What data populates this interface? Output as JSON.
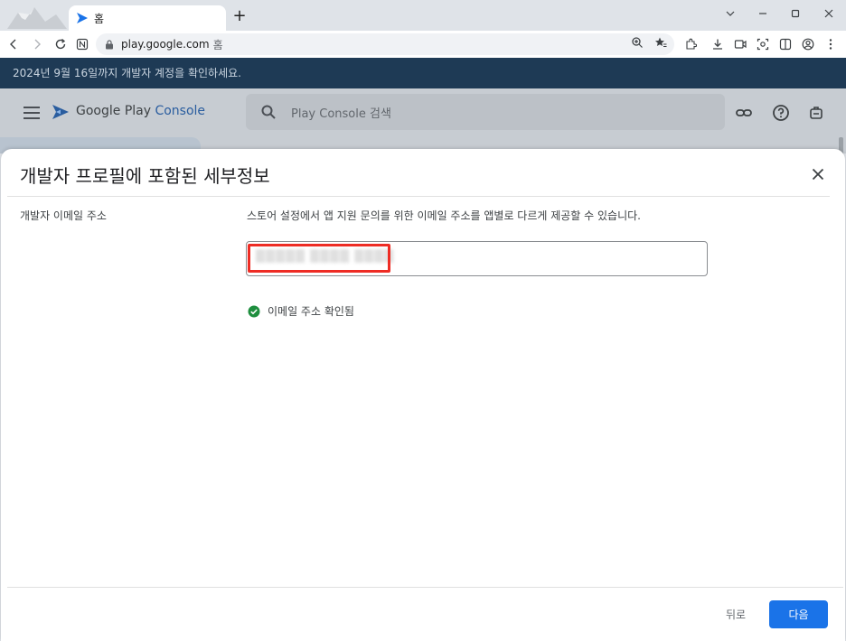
{
  "browser": {
    "tab_title": "홈",
    "new_tab_symbol": "+",
    "url": "play.google.com",
    "url_suffix": "홈"
  },
  "banner": {
    "text": "2024년 9월 16일까지 개발자 계정을 확인하세요."
  },
  "console": {
    "brand_prefix": "Google Play",
    "brand_accent": "Console",
    "search_placeholder": "Play Console 검색"
  },
  "dialog": {
    "title": "개발자 프로필에 포함된 세부정보",
    "field_label": "개발자 이메일 주소",
    "field_help": "스토어 설정에서 앱 지원 문의를 위한 이메일 주소를 앱별로 다르게 제공할 수 있습니다.",
    "email_value": "▒▒▒▒▒ ▒▒▒▒ ▒▒▒▒",
    "verified_text": "이메일 주소 확인됨",
    "back_label": "뒤로",
    "next_label": "다음"
  },
  "colors": {
    "primary": "#1a73e8",
    "success": "#1e8e3e",
    "highlight": "#ee2c24",
    "banner_bg": "#1e3a55"
  },
  "icons": [
    "back-icon",
    "forward-icon",
    "reload-icon",
    "reader-icon",
    "lock-icon",
    "zoom-icon",
    "bookmark-icon",
    "extension-icon",
    "download-icon",
    "cast-icon",
    "screenshot-icon",
    "sidepanel-icon",
    "profile-icon",
    "more-icon",
    "menu-icon",
    "search-icon",
    "link-icon",
    "help-icon",
    "notification-icon",
    "close-icon",
    "check-circle-icon"
  ]
}
